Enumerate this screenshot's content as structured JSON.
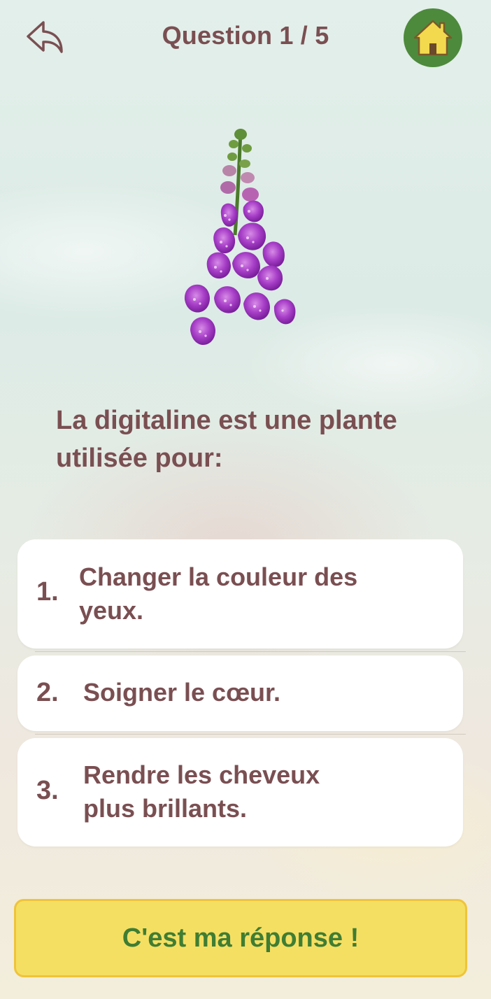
{
  "header": {
    "title": "Question 1 / 5",
    "back_icon": "back-arrow-icon",
    "home_icon": "home-icon"
  },
  "image": {
    "subject": "foxglove-plant"
  },
  "question": {
    "text": "La digitaline est une plante utilisée pour:"
  },
  "answers": [
    {
      "number": "1.",
      "text": "Changer la couleur des yeux."
    },
    {
      "number": "2.",
      "text": "Soigner le cœur."
    },
    {
      "number": "3.",
      "text": "Rendre les cheveux plus brillants."
    }
  ],
  "submit": {
    "label": "C'est ma réponse !"
  },
  "colors": {
    "text": "#7a4f52",
    "home_button": "#4d8a3c",
    "home_icon": "#f3d94e",
    "submit_bg": "#f5df62",
    "submit_text": "#3f7d33"
  }
}
